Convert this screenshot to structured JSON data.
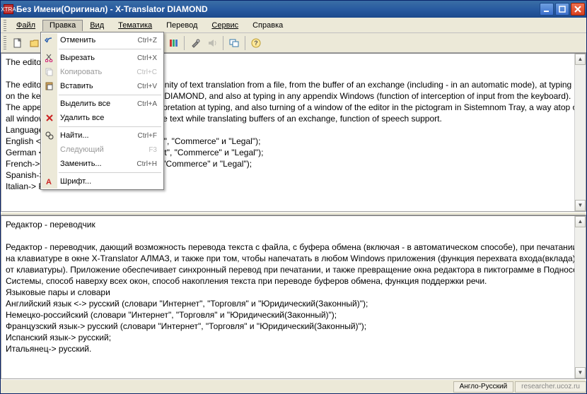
{
  "title": "Без Имени(Оригинал) - X-Translator DIAMOND",
  "menubar": [
    "Файл",
    "Правка",
    "Вид",
    "Тематика",
    "Перевод",
    "Сервис",
    "Справка"
  ],
  "edit_menu": {
    "undo": {
      "label": "Отменить",
      "shortcut": "Ctrl+Z"
    },
    "cut": {
      "label": "Вырезать",
      "shortcut": "Ctrl+X"
    },
    "copy": {
      "label": "Копировать",
      "shortcut": "Ctrl+C"
    },
    "paste": {
      "label": "Вставить",
      "shortcut": "Ctrl+V"
    },
    "select_all": {
      "label": "Выделить все",
      "shortcut": "Ctrl+A"
    },
    "delete_all": {
      "label": "Удалить все",
      "shortcut": ""
    },
    "find": {
      "label": "Найти...",
      "shortcut": "Ctrl+F"
    },
    "next": {
      "label": "Следующий",
      "shortcut": "F3"
    },
    "replace": {
      "label": "Заменить...",
      "shortcut": "Ctrl+H"
    },
    "font": {
      "label": "Шрифт...",
      "shortcut": ""
    }
  },
  "top_pane": {
    "l1": "The editor - translator",
    "l2": "The editor is a translator giving an opportunity of text translation from a file, from the buffer of an exchange (including - in an automatic mode), at typing on the keyboard in a window X-Translator DIAMOND, and also at typing in any appendix Windows (function of interception of input from the keyboard). The appendix provides simultaneous interpretation at typing, and also turning of a window of the editor in the pictogram in Sistemnom Tray, a way atop of all windows, a mode of accumulation of the text while translating buffers of an exchange, function of speech support.",
    "l3": "Language pairs and dictionaries",
    "l4": "English <-> Russian (dictionaries \"Internet\", \"Commerce\" и \"Legal\");",
    "l5": "German <-> Russian (dictionaries \"Internet\", \"Commerce\" и \"Legal\");",
    "l6": "French-> Russian (dictionaries \"Internet\", \"Commerce\" и \"Legal\");",
    "l7": "Spanish-> Russian;",
    "l8": "Italian-> Russian."
  },
  "bottom_pane": {
    "l1": "Редактор - переводчик",
    "l2": "Редактор - переводчик, дающий возможность перевода текста с файла, с буфера обмена (включая - в автоматическом способе), при печатании на клавиатуре в окне X-Translator АЛМАЗ, и также при том, чтобы напечатать в любом Windows приложения (функция перехвата входа(вклада) от клавиатуры). Приложение обеспечивает синхронный перевод при печатании, и также превращение окна редактора в пиктограмме в Подносе Системы, способ наверху всех окон, способ накопления текста при переводе буферов обмена, функция поддержки речи.",
    "l3": "Языковые пары и словари",
    "l4": "Английский язык <-> русский (словари \"Интернет\", \"Торговля\" и \"Юридический(Законный)\");",
    "l5": "Немецко-российский (словари \"Интернет\", \"Торговля\" и \"Юридический(Законный)\");",
    "l6": "Французский язык-> русский (словари \"Интернет\", \"Торговля\" и \"Юридический(Законный)\");",
    "l7": "Испанский язык-> русский;",
    "l8": "Итальянец-> русский."
  },
  "status": {
    "lang": "Англо-Русский",
    "site": "researcher.ucoz.ru"
  },
  "icon_char": {
    "xtra": "XTRA"
  }
}
